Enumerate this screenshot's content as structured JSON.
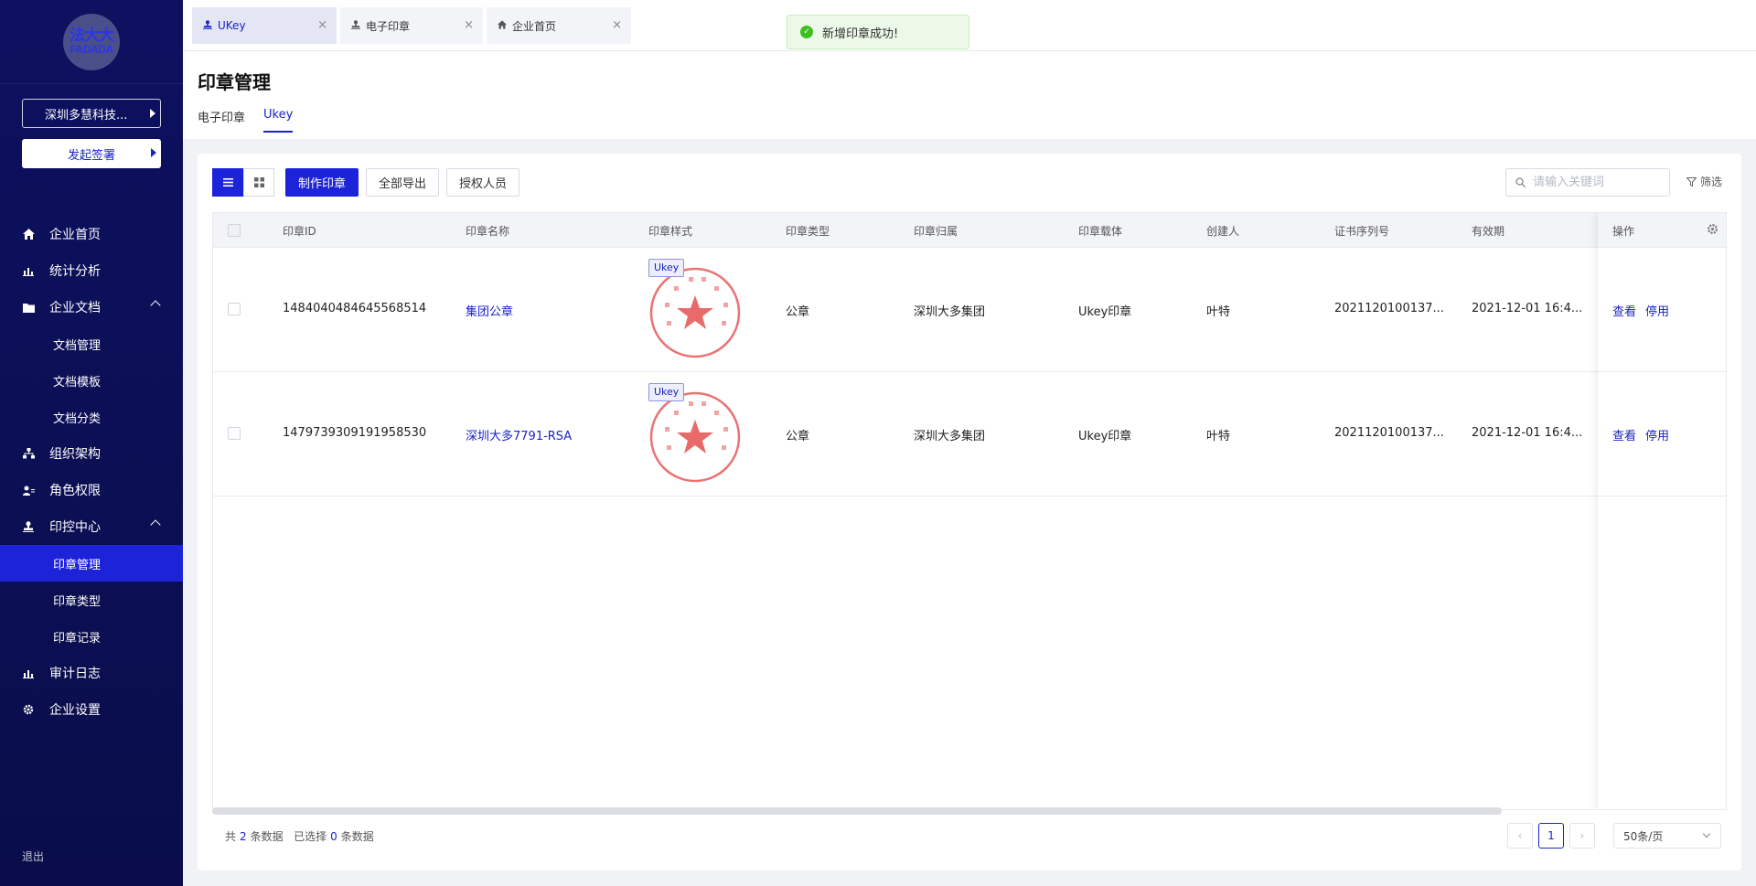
{
  "sidebar": {
    "logo_cn": "法大大",
    "logo_en": "FADADA",
    "company": "深圳多慧科技...",
    "start_sign": "发起签署",
    "items": [
      {
        "label": "企业首页",
        "icon": "home-icon"
      },
      {
        "label": "统计分析",
        "icon": "bar-chart-icon"
      },
      {
        "label": "企业文档",
        "icon": "folder-icon"
      },
      {
        "label": "文档管理"
      },
      {
        "label": "文档模板"
      },
      {
        "label": "文档分类"
      },
      {
        "label": "组织架构",
        "icon": "org-tree-icon"
      },
      {
        "label": "角色权限",
        "icon": "user-role-icon"
      },
      {
        "label": "印控中心",
        "icon": "stamp-icon"
      },
      {
        "label": "印章管理"
      },
      {
        "label": "印章类型"
      },
      {
        "label": "印章记录"
      },
      {
        "label": "审计日志",
        "icon": "bar-chart-icon"
      },
      {
        "label": "企业设置",
        "icon": "gear-icon"
      }
    ],
    "logout": "退出"
  },
  "tabs": [
    {
      "label": "UKey",
      "icon": "stamp-icon"
    },
    {
      "label": "电子印章",
      "icon": "stamp-icon"
    },
    {
      "label": "企业首页",
      "icon": "home-icon"
    }
  ],
  "toast": "新增印章成功!",
  "page": {
    "title": "印章管理",
    "subtabs": [
      "电子印章",
      "Ukey"
    ]
  },
  "toolbar": {
    "make_seal": "制作印章",
    "export_all": "全部导出",
    "authorize": "授权人员",
    "search_placeholder": "请输入关键词",
    "filter": "筛选"
  },
  "table": {
    "headers": [
      "印章ID",
      "印章名称",
      "印章样式",
      "印章类型",
      "印章归属",
      "印章载体",
      "创建人",
      "证书序列号",
      "有效期",
      "操作"
    ],
    "rows": [
      {
        "id": "1484040484645568514",
        "name": "集团公章",
        "tag": "Ukey",
        "type": "公章",
        "owner": "深圳大多集团",
        "carrier": "Ukey印章",
        "creator": "叶特",
        "serial": "2021120100137...",
        "valid": "2021-12-01 16:4...",
        "view": "查看",
        "disable": "停用"
      },
      {
        "id": "1479739309191958530",
        "name": "深圳大多7791-RSA",
        "tag": "Ukey",
        "type": "公章",
        "owner": "深圳大多集团",
        "carrier": "Ukey印章",
        "creator": "叶特",
        "serial": "2021120100137...",
        "valid": "2021-12-01 16:4...",
        "view": "查看",
        "disable": "停用"
      }
    ]
  },
  "footer": {
    "total_prefix": "共",
    "total": "2",
    "total_suffix": "条数据",
    "selected_prefix": "已选择",
    "selected": "0",
    "selected_suffix": "条数据",
    "page": "1",
    "page_size": "50条/页"
  },
  "colors": {
    "sidebar": "#0d1160",
    "accent": "#1d23d8",
    "seal": "#e55a5a",
    "success": "#3fbf1f"
  }
}
